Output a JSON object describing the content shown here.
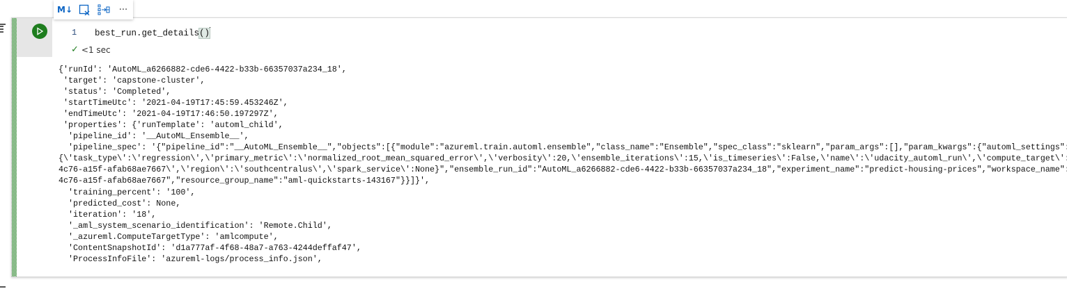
{
  "toolbar": {
    "markdown_label": "M↓",
    "items": [
      "markdown-toggle",
      "clear-output",
      "split-cell",
      "more-options"
    ],
    "more_label": "···"
  },
  "cell": {
    "line_number": "1",
    "code_before": "best_run.get_details",
    "code_parens": "()",
    "status": "<1 sec",
    "accent": "#1e7d1e"
  },
  "output": {
    "lines": [
      "{'runId': 'AutoML_a6266882-cde6-4422-b33b-66357037a234_18',",
      " 'target': 'capstone-cluster',",
      " 'status': 'Completed',",
      " 'startTimeUtc': '2021-04-19T17:45:59.453246Z',",
      " 'endTimeUtc': '2021-04-19T17:46:50.197297Z',",
      " 'properties': {'runTemplate': 'automl_child',",
      "  'pipeline_id': '__AutoML_Ensemble__',",
      "  'pipeline_spec': '{\"pipeline_id\":\"__AutoML_Ensemble__\",\"objects\":[{\"module\":\"azureml.train.automl.ensemble\",\"class_name\":\"Ensemble\",\"spec_class\":\"sklearn\",\"param_args\":[],\"param_kwargs\":{\"automl_settings\":",
      "{\\'task_type\\':\\'regression\\',\\'primary_metric\\':\\'normalized_root_mean_squared_error\\',\\'verbosity\\':20,\\'ensemble_iterations\\':15,\\'is_timeseries\\':False,\\'name\\':\\'udacity_automl_run\\',\\'compute_target\\':",
      "4c76-a15f-afab68ae7667\\',\\'region\\':\\'southcentralus\\',\\'spark_service\\':None}\",\"ensemble_run_id\":\"AutoML_a6266882-cde6-4422-b33b-66357037a234_18\",\"experiment_name\":\"predict-housing-prices\",\"workspace_name\":",
      "4c76-a15f-afab68ae7667\",\"resource_group_name\":\"aml-quickstarts-143167\"}}]}',",
      "  'training_percent': '100',",
      "  'predicted_cost': None,",
      "  'iteration': '18',",
      "  '_aml_system_scenario_identification': 'Remote.Child',",
      "  '_azureml.ComputeTargetType': 'amlcompute',",
      "  'ContentSnapshotId': 'd1a777af-4f68-48a7-a763-4244deffaf47',",
      "  'ProcessInfoFile': 'azureml-logs/process_info.json',"
    ]
  }
}
